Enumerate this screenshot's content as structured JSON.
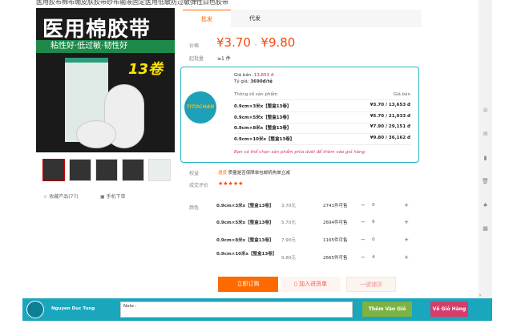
{
  "title": "医用胶布棉布绷皮肤胶带纱布输液固定医用低敏防过敏弹性白色胶带",
  "image": {
    "headline": "医用棉胶带",
    "subline": "粘性好·低过敏·韧性好",
    "count": "13卷"
  },
  "left": {
    "favorite": "收藏产品(77)",
    "mobile": "手机下单"
  },
  "tabs": [
    {
      "label": "批发"
    },
    {
      "label": "代发"
    }
  ],
  "price": {
    "label": "价格",
    "low": "¥3.70",
    "sep": "-",
    "high": "¥9.80",
    "moq_label": "起批量",
    "moq": "≥1 件"
  },
  "ext": {
    "price_label": "Giá bán:",
    "price_value": "13,653 đ",
    "rate_label": "Tỷ giá:",
    "rate_value": "3690đ/tệ",
    "col1": "Thông số sản phẩm",
    "col2": "Giá bán",
    "logo": "TITOCHAN",
    "rows": [
      {
        "spec": "0.9cm×3米x【整盒13卷】",
        "price": "¥3.70 / 13,653 đ"
      },
      {
        "spec": "0.9cm×5米x【整盒13卷】",
        "price": "¥5.70 / 21,033 đ"
      },
      {
        "spec": "0.9cm×8米x【整盒13卷】",
        "price": "¥7.90 / 29,151 đ"
      },
      {
        "spec": "0.9cm×10米x【整盒13卷】",
        "price": "¥9.80 / 36,162 đ"
      }
    ],
    "note": "Bạn có thể chọn sản phẩm phía dưới để thêm vào giỏ hàng."
  },
  "rights": {
    "label": "权益",
    "badge": "退货",
    "text": "质量是否保障单包邮机构单立减",
    "review_label": "成交评价",
    "stars": "★★★★★",
    "rating": 5
  },
  "sku": {
    "label": "颜色",
    "rows": [
      {
        "spec": "0.9cm×3米x【整盒13卷】",
        "price": "3.70元",
        "stock": "2741件可售",
        "qty": "0"
      },
      {
        "spec": "0.9cm×5米x【整盒13卷】",
        "price": "5.70元",
        "stock": "2694件可售",
        "qty": "6"
      },
      {
        "spec": "0.9cm×8米x【整盒13卷】",
        "price": "7.90元",
        "stock": "1165件可售",
        "qty": "0"
      },
      {
        "spec": "0.9cm×10米x【整盒13卷】",
        "price": "9.80元",
        "stock": "2665件可售",
        "qty": "4"
      }
    ]
  },
  "actions": {
    "order": "立即订购",
    "cart": "加入进货单",
    "dist": "一键铺货"
  },
  "bottom": {
    "user": "Nguyen Duc Tung",
    "note": "Note :",
    "add": "Thêm Vào Giỏ Hàng",
    "go": "Về Giỏ Hàng"
  }
}
